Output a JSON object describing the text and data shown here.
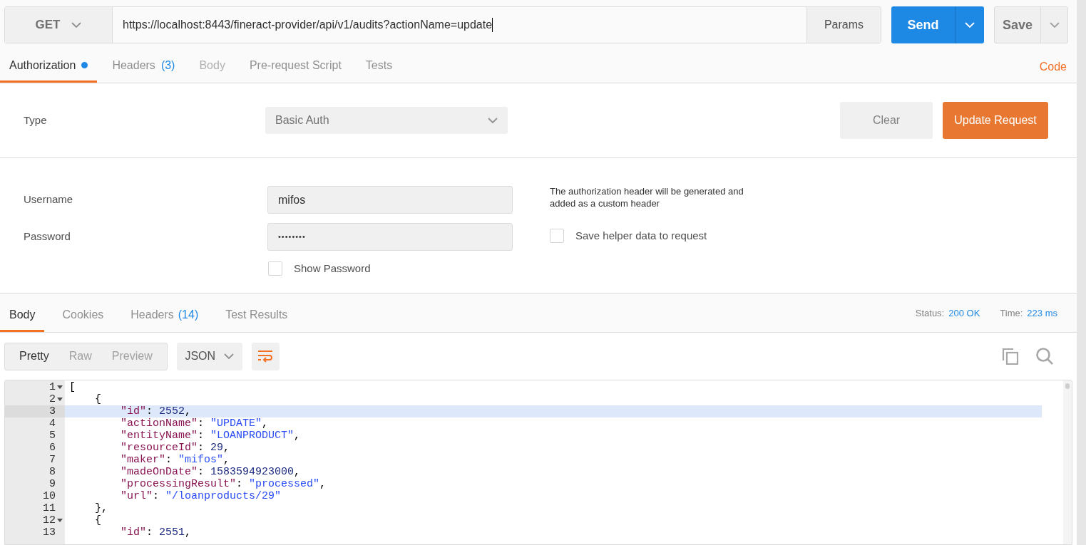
{
  "request": {
    "method": "GET",
    "url": "https://localhost:8443/fineract-provider/api/v1/audits?actionName=update",
    "params_button": "Params",
    "send_button": "Send",
    "save_button": "Save"
  },
  "request_tabs": [
    {
      "label": "Authorization",
      "dot": true,
      "selected": true,
      "disabled": false
    },
    {
      "label": "Headers",
      "count": "(3)",
      "dot": false,
      "selected": false,
      "disabled": false
    },
    {
      "label": "Body",
      "dot": false,
      "selected": false,
      "disabled": true
    },
    {
      "label": "Pre-request Script",
      "dot": false,
      "selected": false,
      "disabled": false
    },
    {
      "label": "Tests",
      "dot": false,
      "selected": false,
      "disabled": false
    }
  ],
  "code_link": "Code",
  "auth": {
    "type_label": "Type",
    "type_value": "Basic Auth",
    "clear_button": "Clear",
    "update_button": "Update Request",
    "username_label": "Username",
    "username": "mifos",
    "password_label": "Password",
    "password": "••••••••",
    "show_password": {
      "label": "Show Password",
      "checked": false
    },
    "helper_note": "The authorization header will be generated and added as a custom header",
    "save_helper": {
      "label": "Save helper data to request",
      "checked": false
    }
  },
  "response_tabs": [
    {
      "label": "Body",
      "selected": true
    },
    {
      "label": "Cookies",
      "selected": false
    },
    {
      "label": "Headers",
      "count": "(14)",
      "selected": false
    },
    {
      "label": "Test Results",
      "selected": false
    }
  ],
  "status": {
    "status_label": "Status:",
    "status_value": "200 OK",
    "time_label": "Time:",
    "time_value": "223 ms"
  },
  "view_modes": [
    {
      "label": "Pretty",
      "selected": true
    },
    {
      "label": "Raw",
      "selected": false
    },
    {
      "label": "Preview",
      "selected": false
    }
  ],
  "format": "JSON",
  "code_lines": [
    {
      "number": "1",
      "foldable": true,
      "active": false,
      "tokens": [
        {
          "kind": "punct",
          "text": "["
        }
      ]
    },
    {
      "number": "2",
      "foldable": true,
      "active": false,
      "tokens": [
        {
          "kind": "punct",
          "text": "    {"
        }
      ]
    },
    {
      "number": "3",
      "foldable": false,
      "active": true,
      "tokens": [
        {
          "kind": "key",
          "text": "        \"id\""
        },
        {
          "kind": "punct",
          "text": ": "
        },
        {
          "kind": "number",
          "text": "2552"
        },
        {
          "kind": "punct",
          "text": ","
        }
      ]
    },
    {
      "number": "4",
      "foldable": false,
      "active": false,
      "tokens": [
        {
          "kind": "key",
          "text": "        \"actionName\""
        },
        {
          "kind": "punct",
          "text": ": "
        },
        {
          "kind": "string",
          "text": "\"UPDATE\""
        },
        {
          "kind": "punct",
          "text": ","
        }
      ]
    },
    {
      "number": "5",
      "foldable": false,
      "active": false,
      "tokens": [
        {
          "kind": "key",
          "text": "        \"entityName\""
        },
        {
          "kind": "punct",
          "text": ": "
        },
        {
          "kind": "string",
          "text": "\"LOANPRODUCT\""
        },
        {
          "kind": "punct",
          "text": ","
        }
      ]
    },
    {
      "number": "6",
      "foldable": false,
      "active": false,
      "tokens": [
        {
          "kind": "key",
          "text": "        \"resourceId\""
        },
        {
          "kind": "punct",
          "text": ": "
        },
        {
          "kind": "number",
          "text": "29"
        },
        {
          "kind": "punct",
          "text": ","
        }
      ]
    },
    {
      "number": "7",
      "foldable": false,
      "active": false,
      "tokens": [
        {
          "kind": "key",
          "text": "        \"maker\""
        },
        {
          "kind": "punct",
          "text": ": "
        },
        {
          "kind": "string",
          "text": "\"mifos\""
        },
        {
          "kind": "punct",
          "text": ","
        }
      ]
    },
    {
      "number": "8",
      "foldable": false,
      "active": false,
      "tokens": [
        {
          "kind": "key",
          "text": "        \"madeOnDate\""
        },
        {
          "kind": "punct",
          "text": ": "
        },
        {
          "kind": "number",
          "text": "1583594923000"
        },
        {
          "kind": "punct",
          "text": ","
        }
      ]
    },
    {
      "number": "9",
      "foldable": false,
      "active": false,
      "tokens": [
        {
          "kind": "key",
          "text": "        \"processingResult\""
        },
        {
          "kind": "punct",
          "text": ": "
        },
        {
          "kind": "string",
          "text": "\"processed\""
        },
        {
          "kind": "punct",
          "text": ","
        }
      ]
    },
    {
      "number": "10",
      "foldable": false,
      "active": false,
      "tokens": [
        {
          "kind": "key",
          "text": "        \"url\""
        },
        {
          "kind": "punct",
          "text": ": "
        },
        {
          "kind": "string",
          "text": "\"/loanproducts/29\""
        }
      ]
    },
    {
      "number": "11",
      "foldable": false,
      "active": false,
      "tokens": [
        {
          "kind": "punct",
          "text": "    },"
        }
      ]
    },
    {
      "number": "12",
      "foldable": true,
      "active": false,
      "tokens": [
        {
          "kind": "punct",
          "text": "    {"
        }
      ]
    },
    {
      "number": "13",
      "foldable": false,
      "active": false,
      "tokens": [
        {
          "kind": "key",
          "text": "        \"id\""
        },
        {
          "kind": "punct",
          "text": ": "
        },
        {
          "kind": "number",
          "text": "2551"
        },
        {
          "kind": "punct",
          "text": ","
        }
      ]
    }
  ]
}
